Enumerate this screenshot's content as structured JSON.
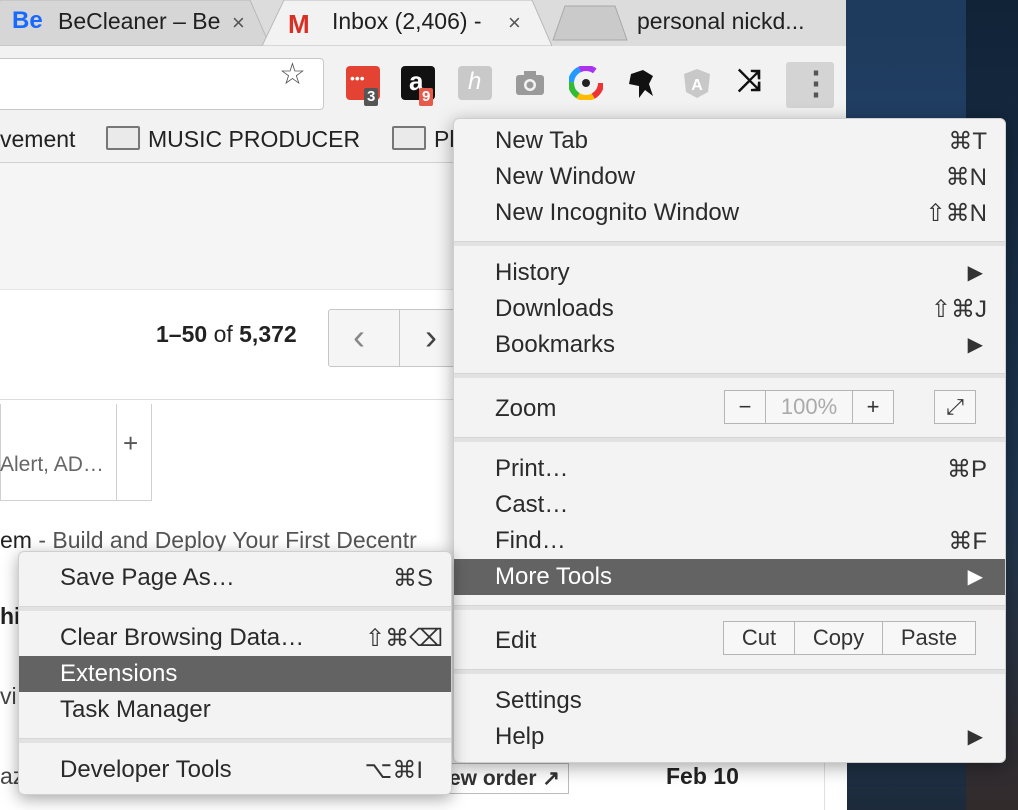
{
  "tabs": [
    {
      "label": "BeCleaner – Be",
      "favicon": "Be",
      "close": "×"
    },
    {
      "label": "Inbox (2,406) -",
      "favicon": "M",
      "close": "×"
    },
    {
      "label": "personal nickd..."
    }
  ],
  "toolbar": {
    "star": "☆",
    "extensions": [
      {
        "name": "todoist-extension",
        "badge": "3"
      },
      {
        "name": "amazon-extension",
        "badge": "9",
        "glyph": "a"
      },
      {
        "name": "honey-extension",
        "glyph": "h"
      },
      {
        "name": "camera-extension"
      },
      {
        "name": "color-wheel-extension"
      },
      {
        "name": "ninja-extension"
      },
      {
        "name": "angular-extension",
        "glyph": "A"
      },
      {
        "name": "shuffle-extension",
        "glyph": "⤨"
      }
    ],
    "menu_glyph": "⋮"
  },
  "bookmarks": [
    {
      "label": "vement"
    },
    {
      "label": "MUSIC PRODUCER"
    },
    {
      "label": "Pl"
    }
  ],
  "gmail": {
    "pager_range": "1–50",
    "pager_of": "of",
    "pager_total": "5,372",
    "prev": "‹",
    "next": "›",
    "category_text": "Alert, AD…",
    "category_plus": "+",
    "row1_sender": "em",
    "row1_subject": " - Build and Deploy Your First Decentr",
    "row_frag_a": "hip",
    "row_frag_b": "vi",
    "row_frag_c": "az",
    "new_order": "ew order ↗",
    "date": "Feb 10"
  },
  "main_menu": {
    "items": [
      {
        "label": "New Tab",
        "shortcut": "⌘T"
      },
      {
        "label": "New Window",
        "shortcut": "⌘N"
      },
      {
        "label": "New Incognito Window",
        "shortcut": "⇧⌘N"
      },
      {
        "label": "History",
        "arrow": "▶"
      },
      {
        "label": "Downloads",
        "shortcut": "⇧⌘J"
      },
      {
        "label": "Bookmarks",
        "arrow": "▶"
      },
      {
        "label": "Zoom"
      },
      {
        "label": "Print…",
        "shortcut": "⌘P"
      },
      {
        "label": "Cast…"
      },
      {
        "label": "Find…",
        "shortcut": "⌘F"
      },
      {
        "label": "More Tools",
        "arrow": "▶",
        "highlighted": true
      },
      {
        "label": "Edit"
      },
      {
        "label": "Settings"
      },
      {
        "label": "Help",
        "arrow": "▶"
      }
    ],
    "zoom": {
      "minus": "−",
      "value": "100%",
      "plus": "+",
      "fullscreen": "⤢"
    },
    "edit": {
      "cut": "Cut",
      "copy": "Copy",
      "paste": "Paste"
    }
  },
  "more_tools_menu": {
    "items": [
      {
        "label": "Save Page As…",
        "shortcut": "⌘S"
      },
      {
        "label": "Clear Browsing Data…",
        "shortcut": "⇧⌘⌫"
      },
      {
        "label": "Extensions",
        "highlighted": true
      },
      {
        "label": "Task Manager"
      },
      {
        "label": "Developer Tools",
        "shortcut": "⌥⌘I"
      }
    ]
  },
  "colors": {
    "highlight": "#636363",
    "menu_bg": "#f3f3f3",
    "behance_blue": "#1769ff",
    "gmail_red": "#d93025"
  }
}
